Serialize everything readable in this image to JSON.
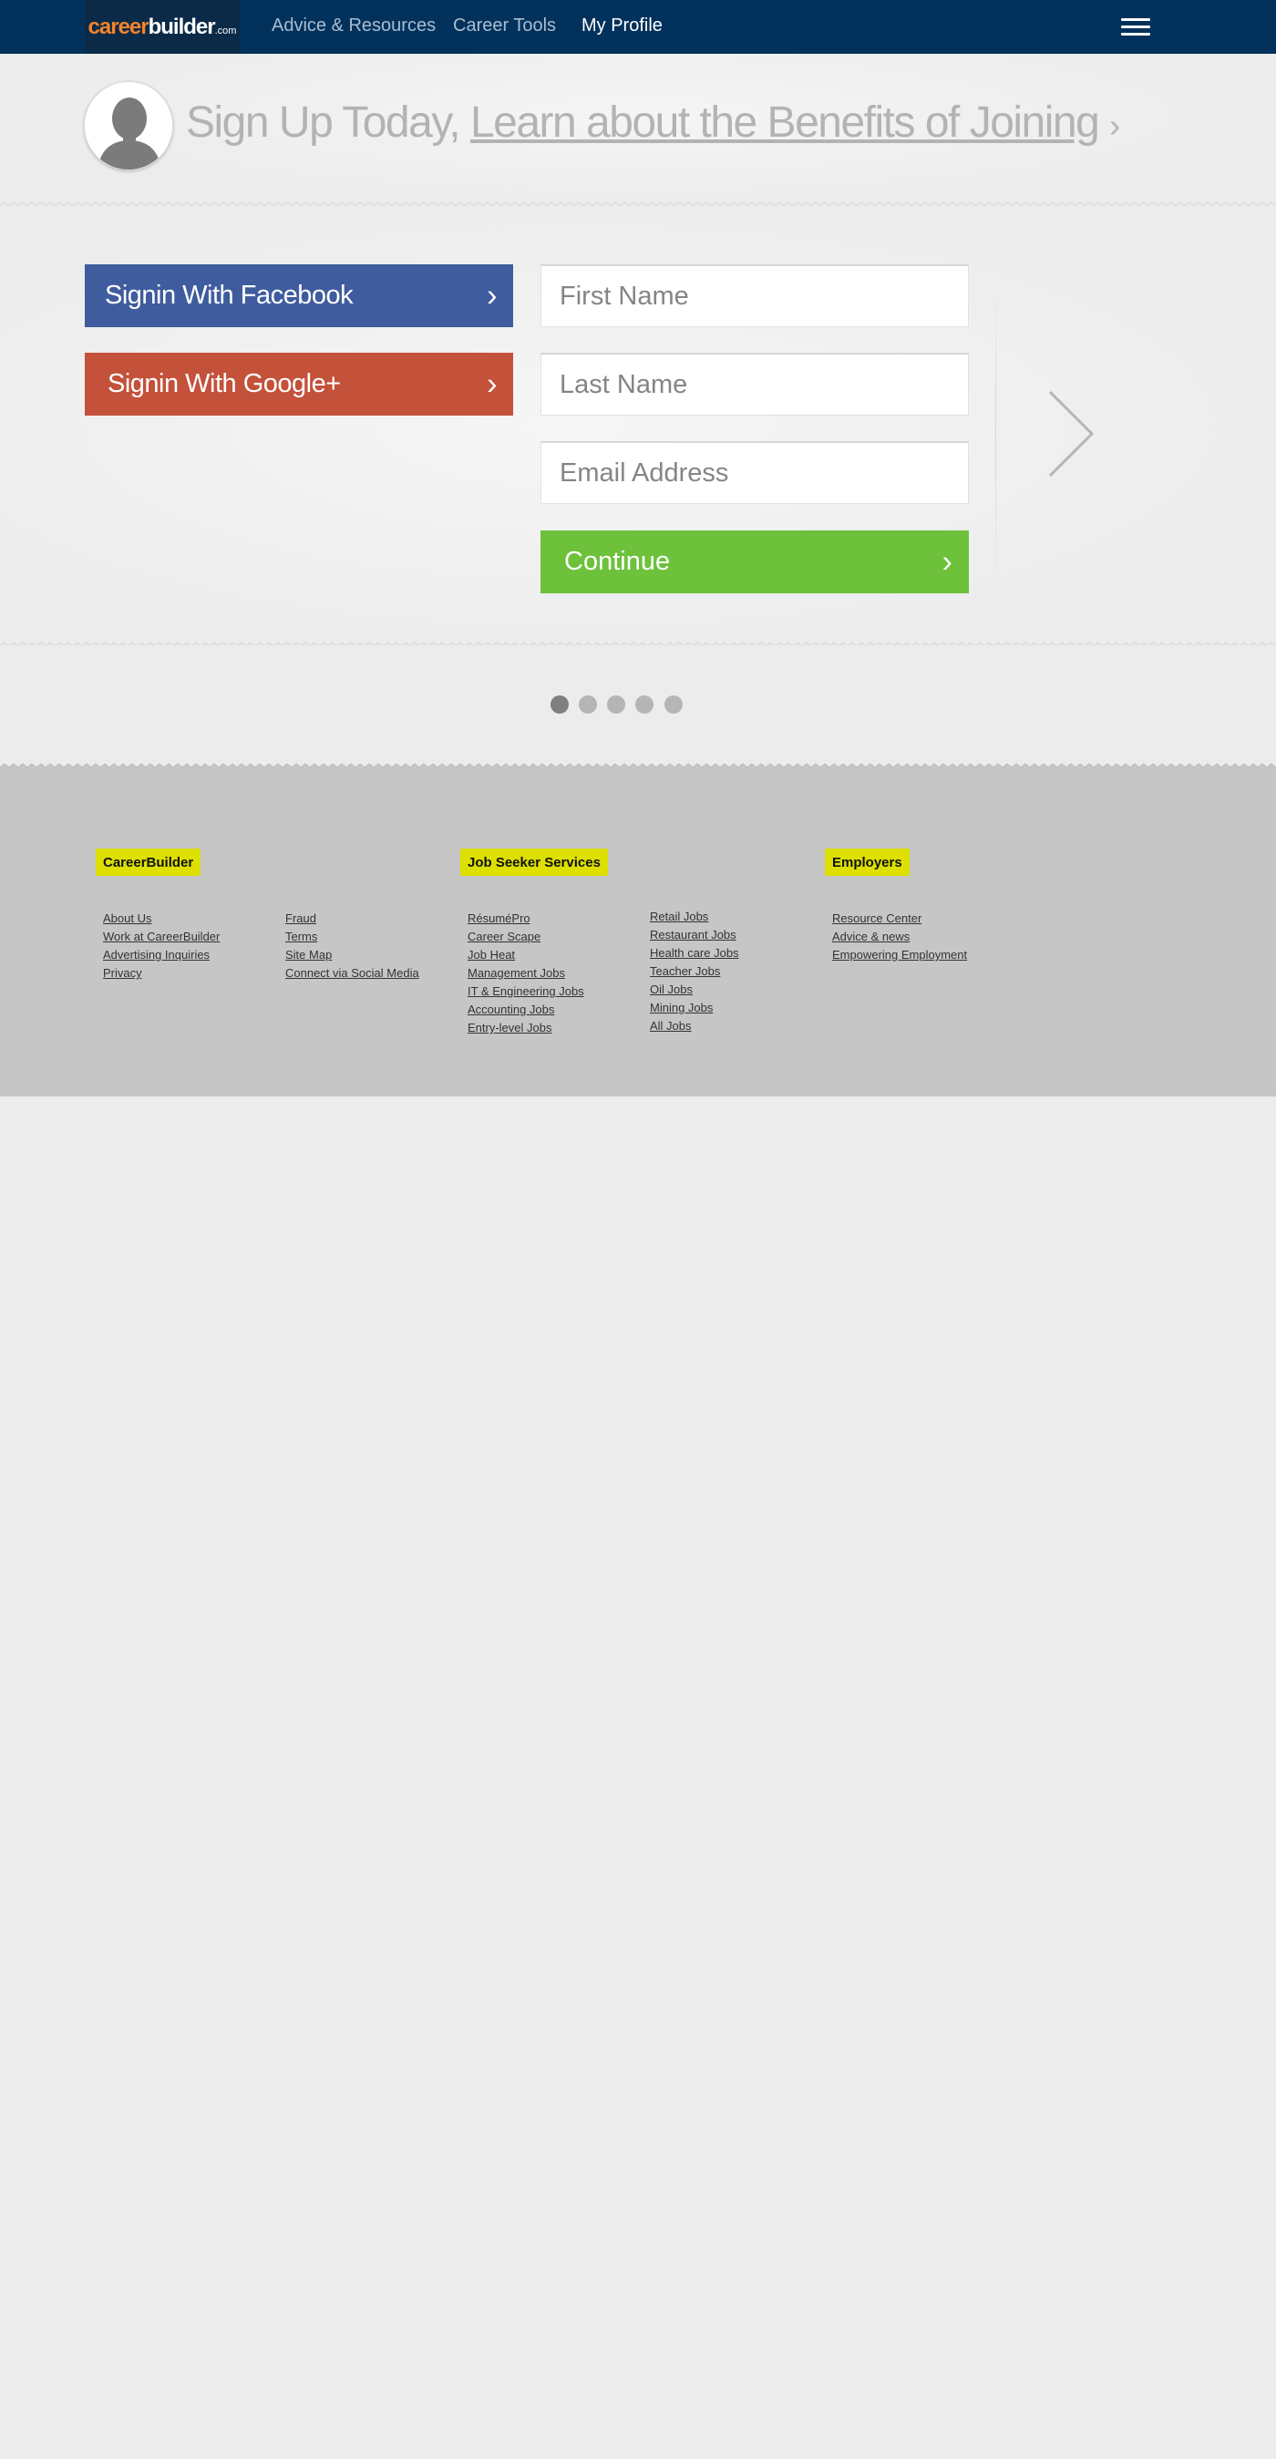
{
  "nav": {
    "logo_part1": "career",
    "logo_part2": "builder",
    "logo_part3": ".com",
    "links": [
      "Advice & Resources",
      "Career Tools",
      "My Profile"
    ],
    "menu_icon": "hamburger-icon"
  },
  "banner": {
    "heading_prefix": "Sign Up Today,",
    "heading_link": "Learn about the Benefits of Joining",
    "heading_chevron": "›",
    "avatar_icon": "user-silhouette-icon"
  },
  "social": {
    "facebook_label": "Signin With Facebook",
    "google_label": "Signin With Google+",
    "chevron": "›"
  },
  "form": {
    "first_name_placeholder": "First Name",
    "last_name_placeholder": "Last Name",
    "email_placeholder": "Email Address",
    "continue_label": "Continue"
  },
  "pager": {
    "total": 5,
    "active_index": 0
  },
  "footer": {
    "sections": [
      {
        "heading": "CareerBuilder",
        "columns": [
          [
            "About Us",
            "Work at CareerBuilder",
            "Advertising Inquiries",
            "Privacy"
          ],
          [
            "Fraud",
            "Terms",
            "Site Map",
            "Connect via Social Media"
          ]
        ]
      },
      {
        "heading": "Job Seeker Services",
        "columns": [
          [
            "RésuméPro",
            "Career Scape",
            "Job Heat",
            "Management Jobs",
            "IT & Engineering Jobs",
            "Accounting Jobs",
            "Entry-level Jobs"
          ],
          [
            "Retail Jobs",
            "Restaurant Jobs",
            "Health care Jobs",
            "Teacher Jobs",
            "Oil Jobs",
            "Mining Jobs",
            "All Jobs"
          ]
        ]
      },
      {
        "heading": "Employers",
        "columns": [
          [
            "Resource Center",
            "Advice & news",
            "Empowering Employment"
          ]
        ]
      }
    ]
  },
  "colors": {
    "nav_bg": "#02325c",
    "facebook": "#3f5d9e",
    "google": "#c4513a",
    "continue": "#6dc13b",
    "footer_bg": "#c6c6c6",
    "footer_heading_bg": "#dde000",
    "logo_orange": "#f5822a"
  }
}
